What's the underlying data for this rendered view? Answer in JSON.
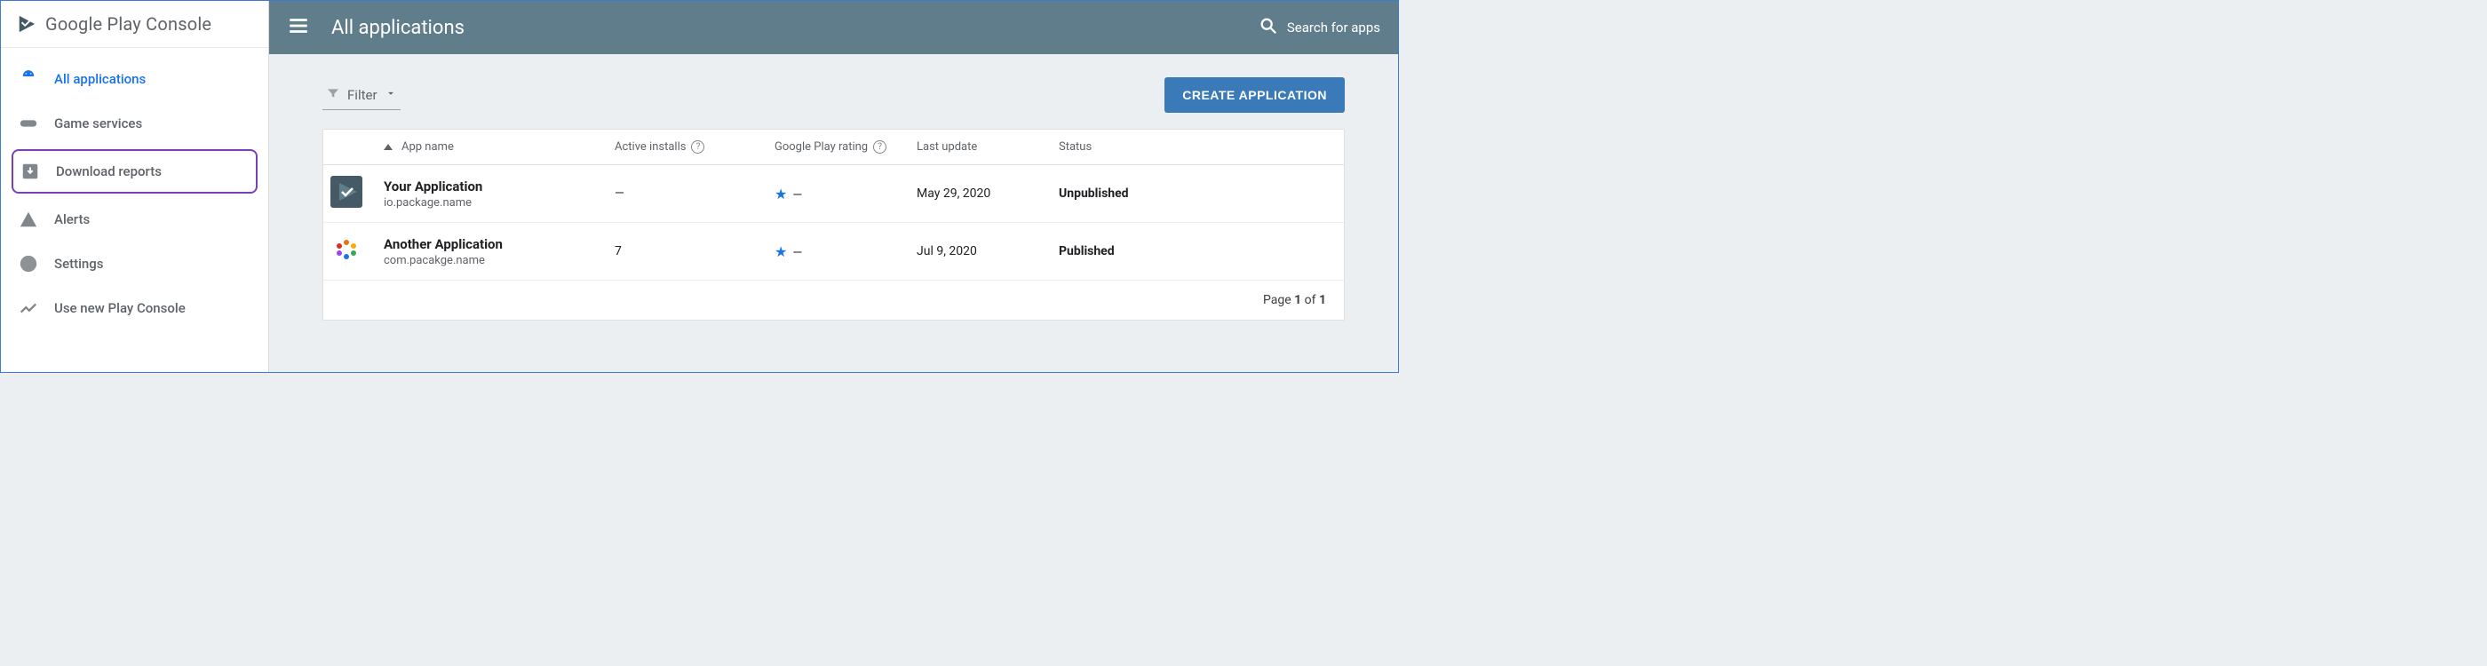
{
  "logo": {
    "text": "Google Play Console"
  },
  "sidebar": {
    "items": [
      {
        "label": "All applications"
      },
      {
        "label": "Game services"
      },
      {
        "label": "Download reports"
      },
      {
        "label": "Alerts"
      },
      {
        "label": "Settings"
      },
      {
        "label": "Use new Play Console"
      }
    ]
  },
  "topbar": {
    "title": "All applications",
    "search_label": "Search for apps"
  },
  "toolbar": {
    "filter_label": "Filter",
    "create_label": "CREATE APPLICATION"
  },
  "table": {
    "headers": {
      "app_name": "App name",
      "active_installs": "Active installs",
      "rating": "Google Play rating",
      "last_update": "Last update",
      "status": "Status"
    },
    "rows": [
      {
        "name": "Your Application",
        "package": "io.package.name",
        "active_installs": "—",
        "rating": "—",
        "last_update": "May 29, 2020",
        "status": "Unpublished"
      },
      {
        "name": "Another Application",
        "package": "com.pacakge.name",
        "active_installs": "7",
        "rating": "—",
        "last_update": "Jul 9, 2020",
        "status": "Published"
      }
    ]
  },
  "pager": {
    "prefix": "Page ",
    "current": "1",
    "of": " of ",
    "total": "1"
  }
}
